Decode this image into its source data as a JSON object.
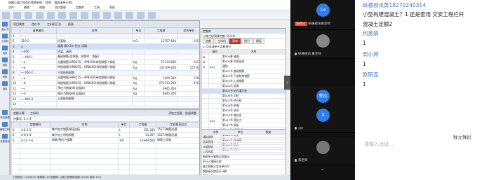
{
  "app": {
    "title": "纵横公路工程造价管理系统 - [项目：路面清单示例]",
    "menus": [
      "文件",
      "编辑",
      "视图",
      "项目管理",
      "定额库",
      "工具",
      "帮助"
    ],
    "left_nav": [
      "造价书",
      "工料机",
      "取费",
      "报表",
      "审核",
      "指标"
    ],
    "left_nav_bottom": [
      "项目管理",
      "编辑工料机",
      "变更查询"
    ],
    "tabs": [
      "项目属性",
      "造价书",
      "工料机汇总",
      "报表"
    ],
    "grid_headers": [
      "",
      "清单编号",
      "名称",
      "单位",
      "工程量",
      "综合单价"
    ],
    "rows": [
      {
        "n": "1",
        "code": "",
        "name": "",
        "unit": "",
        "qty": "",
        "price": "",
        "cls": "grp"
      },
      {
        "n": "2",
        "code": "319-2",
        "name": "砼基础",
        "unit": "m3",
        "qty": "12557.600",
        "price": "6.02",
        "cls": ""
      },
      {
        "n": "3",
        "code": "a",
        "name": "路基 厚0.2m 挖方 培填",
        "unit": "",
        "qty": "",
        "price": "",
        "cls": "sel"
      },
      {
        "n": "4",
        "code": "—400",
        "name": "桥梁、涵洞",
        "unit": "",
        "qty": "",
        "price": "",
        "cls": "grp"
      },
      {
        "n": "5",
        "code": "— 400-1",
        "name": "基础钢筋(含钢筋、预埋件、钢板)",
        "unit": "",
        "qty": "",
        "price": "",
        "cls": ""
      },
      {
        "n": "6",
        "code": "—a",
        "name": "光圆钢筋(HPB235、HPB300)带肋钢筋+钢板",
        "unit": "kg",
        "qty": "15113.600",
        "price": "6.07",
        "cls": ""
      },
      {
        "n": "7",
        "code": "—b",
        "name": "带肋钢筋(HRB335、HRB400)带肋钢筋+钢板",
        "unit": "kg",
        "qty": "135109.600",
        "price": "257.92",
        "cls": ""
      },
      {
        "n": "8",
        "code": "— 400-2",
        "name": "下部结构钢筋",
        "unit": "",
        "qty": "",
        "price": "",
        "cls": "grp"
      },
      {
        "n": "9",
        "code": "—a",
        "name": "光圆钢筋(HPB235、HPB300)带肋钢筋+钢板",
        "unit": "kg",
        "qty": "7400.300",
        "price": "5.91",
        "cls": ""
      },
      {
        "n": "10",
        "code": "—b",
        "name": "带肋钢筋(HRB335、HRB400)带肋钢筋+钢板",
        "unit": "kg",
        "qty": "271513.200",
        "price": "4.92",
        "cls": ""
      },
      {
        "n": "11",
        "code": "—c",
        "name": "预应力钢绞线(含锚具)",
        "unit": "kg",
        "qty": "6945.300",
        "price": "",
        "cls": ""
      },
      {
        "n": "12",
        "code": "—d",
        "name": "预应力钢绞线(含锚具)",
        "unit": "kg",
        "qty": "6945.300",
        "price": "",
        "cls": ""
      },
      {
        "n": "13",
        "code": "— 400-3",
        "name": "上部结构钢筋",
        "unit": "",
        "qty": "",
        "price": "",
        "cls": "grp"
      },
      {
        "n": "14",
        "code": "",
        "name": "",
        "unit": "",
        "qty": "",
        "price": "",
        "cls": ""
      }
    ],
    "lower_tabs": [
      "定额计算",
      "工料机"
    ],
    "lower_right_buttons": [
      "添加工程量",
      "批量调整"
    ],
    "lower_subtoolbar": "计算式: 1 > 4",
    "lower_headers": [
      "",
      "定额编号",
      "名称",
      "单位",
      "工程量",
      "工程量表达式"
    ],
    "lower_rows": [
      {
        "n": "1",
        "code": "4-6-3-3",
        "name": "集中加工钢筋焊接连接",
        "unit": "t",
        "qty": "151.343",
        "expr": "15173钢筋总量"
      },
      {
        "n": "2",
        "code": "4-6-4-4",
        "name": "集中加工带肋钢筋",
        "unit": "t",
        "qty": "14.567",
        "expr": "15173钢筋总量"
      },
      {
        "n": "3",
        "code": "4-11-7-6",
        "name": "钢筋/预应力钢筋",
        "unit": "10t",
        "qty": "15949.600",
        "expr": "钢筋工程量"
      }
    ],
    "right_panel": {
      "title": "定额库",
      "subtitle": "公路工程预算定额 (2018)",
      "tabs": [
        "定额",
        "工料机",
        "清单",
        "指引",
        "模板"
      ],
      "check": "包含清单+定额指引",
      "headers": [
        "",
        "编号",
        "名称"
      ],
      "rows": [
        {
          "a": "⊞",
          "b": "",
          "c": "第500章 隧道"
        },
        {
          "a": "⊞",
          "b": "",
          "c": "第400章 桥梁涵洞"
        },
        {
          "a": "⊟",
          "b": "401",
          "c": "通则"
        },
        {
          "a": "",
          "b": "",
          "c": "第401节 基础钢筋"
        },
        {
          "a": "",
          "b": "",
          "c": "第402节 下部结构钢筋"
        },
        {
          "a": "",
          "b": "",
          "c": "第403节 上部钢筋"
        },
        {
          "a": "",
          "b": "",
          "c": "第404节 涵洞"
        },
        {
          "a": "",
          "b": "",
          "c": "第405节 钻孔灌注桩"
        },
        {
          "a": "",
          "b": "",
          "c": "第406节 沉桩"
        },
        {
          "a": "",
          "b": "",
          "c": "第407节 挖孔桩"
        },
        {
          "a": "",
          "b": "",
          "c": "第408节 桩基"
        },
        {
          "a": "",
          "b": "",
          "c": "第409节 承台"
        },
        {
          "a": "",
          "b": "",
          "c": "第410节 墩台身"
        },
        {
          "a": "",
          "b": "403",
          "c": "第411节 预应力"
        },
        {
          "a": "",
          "b": "",
          "c": "第412节 梁板"
        },
        {
          "a": "",
          "b": "",
          "c": "第413节 桥面铺装"
        },
        {
          "a": "",
          "b": "",
          "c": "第414节 支座"
        },
        {
          "a": "",
          "b": "",
          "c": "第415节 伸缩缝"
        },
        {
          "a": "",
          "b": "",
          "c": "第416节 防水"
        },
        {
          "a": "",
          "b": "",
          "c": "第417节 栏杆"
        }
      ],
      "bottom_headers": [
        "名称",
        "单位",
        "数量"
      ],
      "bottom_rows": [
        {
          "a": "",
          "b": "",
          "c": "通则说明"
        },
        {
          "a": "",
          "b": "",
          "c": "适用范围"
        },
        {
          "a": "",
          "b": "",
          "c": "计量规则"
        },
        {
          "a": "",
          "b": "",
          "c": "工程内容"
        },
        {
          "a": "",
          "b": "",
          "c": "图纸所示钢筋以质量计"
        },
        {
          "a": "",
          "b": "",
          "c": "不计入搭接长度"
        },
        {
          "a": "",
          "b": "",
          "c": "施工损耗已含在单价内"
        },
        {
          "a": "",
          "b": "",
          "c": "钢筋接头按设计计算"
        },
        {
          "a": "",
          "b": "",
          "c": "预埋件另计"
        }
      ]
    },
    "status": "工程造价: 12345.67   清单数: 14   定额库: 公路工程预算定额 (2018)   版本 10.0"
  },
  "video": {
    "tiles": [
      {
        "initials": "14",
        "name": "",
        "color": "#2f7ee6"
      },
      {
        "initials": "",
        "name": "纵横视讯 黄老师",
        "color": "#888888"
      },
      {
        "initials": "菲拉",
        "name": "艾丽佳娃",
        "color": "#2f7ee6"
      },
      {
        "initials": "X",
        "name": "xhf",
        "color": "#2f7ee6"
      },
      {
        "initials": "",
        "name": "黄老师",
        "color": "#777777"
      }
    ],
    "host_label": "主持人",
    "host_name": "纵横视讯黄老师",
    "chevron": "⌄"
  },
  "chat": {
    "lines": [
      {
        "text": "纵横视讯黄18270240314",
        "cls": "name"
      },
      {
        "text": "小型构建混凝土？1 还是套用 交安工程栏杆",
        "cls": ""
      },
      {
        "text": "混凝土定额2",
        "cls": ""
      },
      {
        "text": "何旻婧",
        "cls": "name"
      },
      {
        "text": "1",
        "cls": ""
      },
      {
        "text": "周小婷",
        "cls": "name"
      },
      {
        "text": "1",
        "cls": ""
      },
      {
        "text": "欧阳连",
        "cls": "name"
      },
      {
        "text": "1",
        "cls": ""
      }
    ],
    "placeholder": "请输入消息...",
    "popout": "独立弹出"
  }
}
